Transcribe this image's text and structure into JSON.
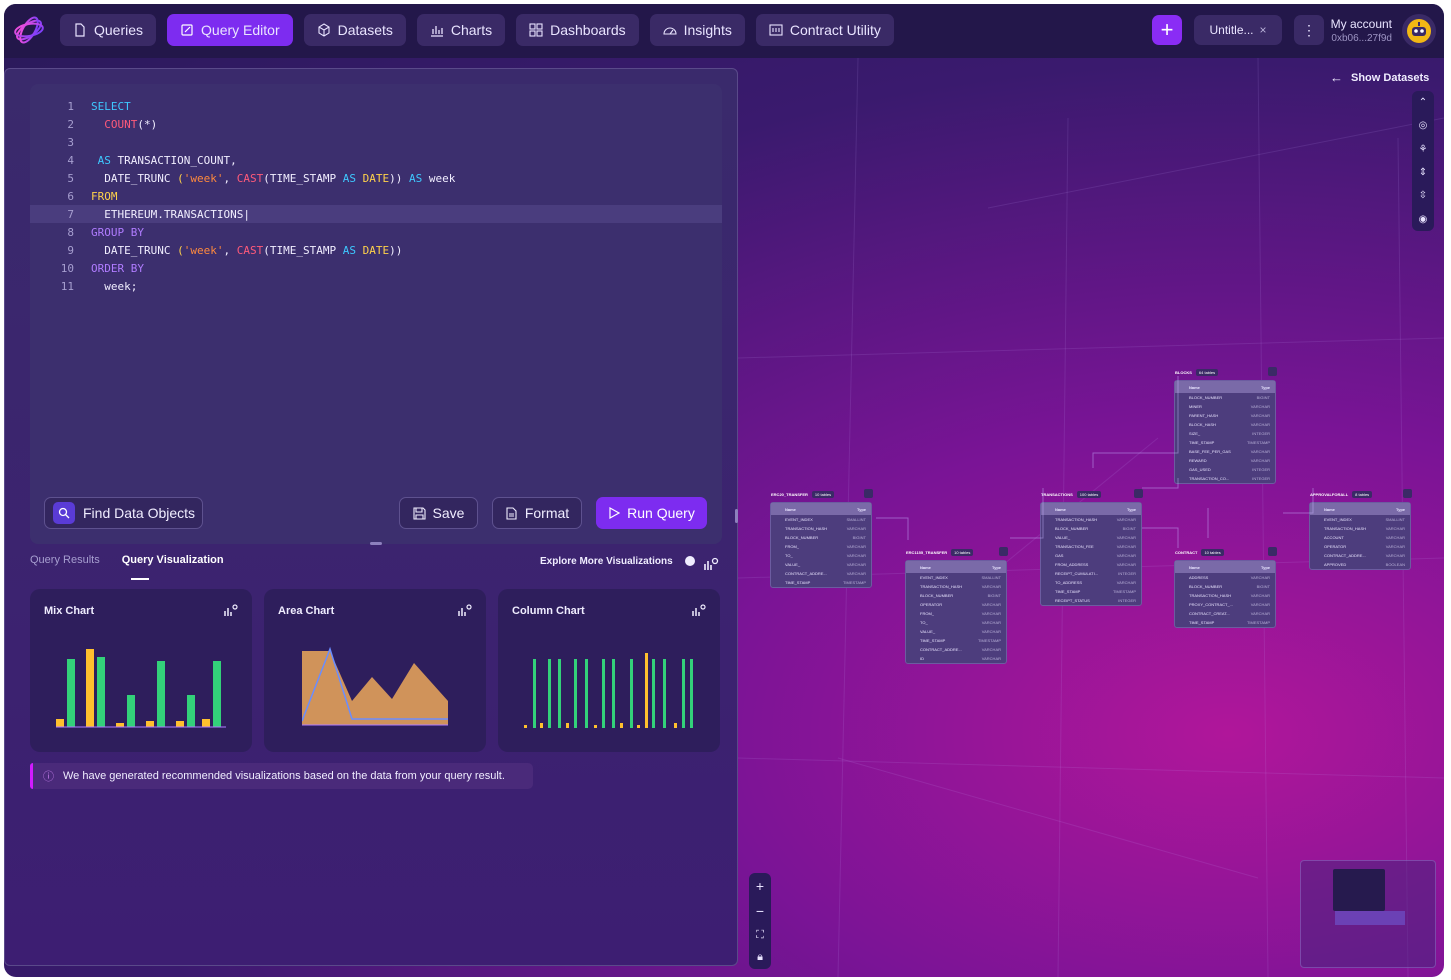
{
  "nav": {
    "items": [
      {
        "label": "Queries",
        "icon": "file-icon"
      },
      {
        "label": "Query Editor",
        "icon": "edit-icon",
        "active": true
      },
      {
        "label": "Datasets",
        "icon": "cube-icon"
      },
      {
        "label": "Charts",
        "icon": "bar-chart-icon"
      },
      {
        "label": "Dashboards",
        "icon": "grid-icon"
      },
      {
        "label": "Insights",
        "icon": "gauge-icon"
      },
      {
        "label": "Contract Utility",
        "icon": "calculator-icon"
      }
    ],
    "tab_label": "Untitle...",
    "account_label": "My account",
    "account_address": "0xb06...27f9d"
  },
  "editor": {
    "lines": [
      {
        "n": "1"
      },
      {
        "n": "2"
      },
      {
        "n": "3"
      },
      {
        "n": "4"
      },
      {
        "n": "5"
      },
      {
        "n": "6"
      },
      {
        "n": "7"
      },
      {
        "n": "8"
      },
      {
        "n": "9"
      },
      {
        "n": "10"
      },
      {
        "n": "11"
      }
    ],
    "t": {
      "select": "SELECT",
      "count": "COUNT",
      "count_args": "(*)",
      "as": "AS",
      "tx_count": "TRANSACTION_COUNT,",
      "date_trunc": "DATE_TRUNC",
      "open": "(",
      "week_str": "'week'",
      "comma": ",",
      "cast": "CAST",
      "time_stamp": "(TIME_STAMP",
      "date": "DATE",
      "close2": "))",
      "week_alias": "week",
      "from": "FROM",
      "table": "ETHEREUM.TRANSACTIONS",
      "group_by": "GROUP BY",
      "order_by": "ORDER BY",
      "week_end": "week;"
    }
  },
  "actions": {
    "find": "Find Data Objects",
    "save": "Save",
    "format": "Format",
    "run": "Run Query"
  },
  "results": {
    "tabs": [
      "Query Results",
      "Query Visualization"
    ],
    "active_tab": "Query Visualization",
    "explore": "Explore More Visualizations",
    "cards": [
      {
        "title": "Mix Chart"
      },
      {
        "title": "Area Chart"
      },
      {
        "title": "Column Chart"
      }
    ],
    "note": "We have generated recommended visualizations based on the data from your query result."
  },
  "canvas": {
    "show_datasets": "Show Datasets",
    "tables": [
      {
        "name": "ERC20_TRANSFER",
        "count": "10 tables",
        "cols": [
          [
            "EVENT_INDEX",
            "SMALLINT"
          ],
          [
            "TRANSACTION_HASH",
            "VARCHAR"
          ],
          [
            "BLOCK_NUMBER",
            "BIGINT"
          ],
          [
            "FROM_",
            "VARCHAR"
          ],
          [
            "TO_",
            "VARCHAR"
          ],
          [
            "VALUE_",
            "VARCHAR"
          ],
          [
            "CONTRACT_ADDRE...",
            "VARCHAR"
          ],
          [
            "TIME_STAMP",
            "TIMESTAMP"
          ]
        ]
      },
      {
        "name": "ERC1155_TRANSFER",
        "count": "10 tables",
        "cols": [
          [
            "EVENT_INDEX",
            "SMALLINT"
          ],
          [
            "TRANSACTION_HASH",
            "VARCHAR"
          ],
          [
            "BLOCK_NUMBER",
            "BIGINT"
          ],
          [
            "OPERATOR",
            "VARCHAR"
          ],
          [
            "FROM_",
            "VARCHAR"
          ],
          [
            "TO_",
            "VARCHAR"
          ],
          [
            "VALUE_",
            "VARCHAR"
          ],
          [
            "TIME_STAMP",
            "TIMESTAMP"
          ],
          [
            "CONTRACT_ADDRE...",
            "VARCHAR"
          ],
          [
            "ID",
            "VARCHAR"
          ]
        ]
      },
      {
        "name": "TRANSACTIONS",
        "count": "100 tables",
        "cols": [
          [
            "TRANSACTION_HASH",
            "VARCHAR"
          ],
          [
            "BLOCK_NUMBER",
            "BIGINT"
          ],
          [
            "VALUE_",
            "VARCHAR"
          ],
          [
            "TRANSACTION_FEE",
            "VARCHAR"
          ],
          [
            "GAS",
            "VARCHAR"
          ],
          [
            "FROM_ADDRESS",
            "VARCHAR"
          ],
          [
            "RECEIPT_CUMULATI...",
            "INTEGER"
          ],
          [
            "TO_ADDRESS",
            "VARCHAR"
          ],
          [
            "TIME_STAMP",
            "TIMESTAMP"
          ],
          [
            "RECEIPT_STATUS",
            "INTEGER"
          ]
        ]
      },
      {
        "name": "BLOCKS",
        "count": "64 tables",
        "cols": [
          [
            "BLOCK_NUMBER",
            "BIGINT"
          ],
          [
            "MINER",
            "VARCHAR"
          ],
          [
            "PARENT_HASH",
            "VARCHAR"
          ],
          [
            "BLOCK_HASH",
            "VARCHAR"
          ],
          [
            "SIZE_",
            "INTEGER"
          ],
          [
            "TIME_STAMP",
            "TIMESTAMP"
          ],
          [
            "BASE_FEE_PER_GAS",
            "VARCHAR"
          ],
          [
            "REWARD",
            "VARCHAR"
          ],
          [
            "GAS_USED",
            "INTEGER"
          ],
          [
            "TRANSACTION_CO...",
            "INTEGER"
          ]
        ]
      },
      {
        "name": "CONTRACT",
        "count": "10 tables",
        "cols": [
          [
            "ADDRESS",
            "VARCHAR"
          ],
          [
            "BLOCK_NUMBER",
            "BIGINT"
          ],
          [
            "TRANSACTION_HASH",
            "VARCHAR"
          ],
          [
            "PROXY_CONTRACT_...",
            "VARCHAR"
          ],
          [
            "CONTRACT_CREAT...",
            "VARCHAR"
          ],
          [
            "TIME_STAMP",
            "TIMESTAMP"
          ]
        ]
      },
      {
        "name": "APPROVALFORALL",
        "count": "8 tables",
        "cols": [
          [
            "EVENT_INDEX",
            "SMALLINT"
          ],
          [
            "TRANSACTION_HASH",
            "VARCHAR"
          ],
          [
            "ACCOUNT",
            "VARCHAR"
          ],
          [
            "OPERATOR",
            "VARCHAR"
          ],
          [
            "CONTRACT_ADDRE...",
            "VARCHAR"
          ],
          [
            "APPROVED",
            "BOOLEAN"
          ]
        ]
      }
    ],
    "col_header_name": "Name",
    "col_header_type": "Type"
  },
  "colors": {
    "accent": "#7d2cf0",
    "active_nav": "#7d2cf0",
    "background": "#2a1a5a"
  }
}
